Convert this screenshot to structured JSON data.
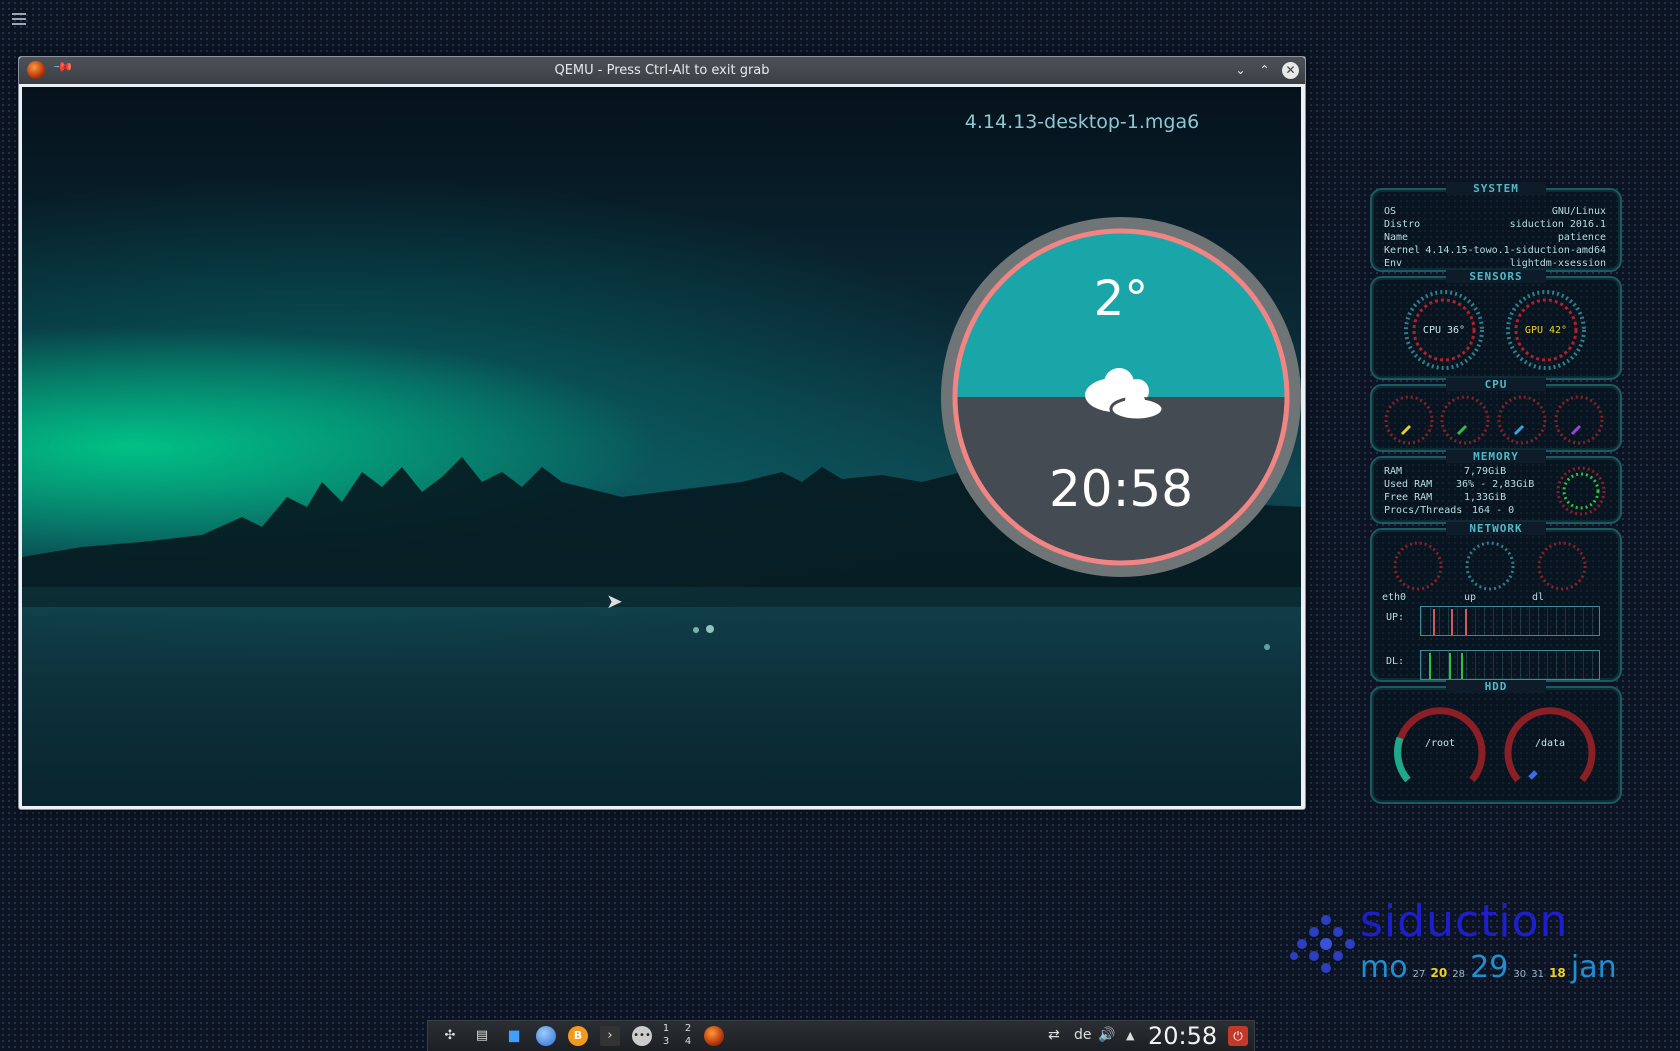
{
  "desktop": {
    "menu_icon": "hamburger-icon"
  },
  "qemu": {
    "title": "QEMU - Press Ctrl-Alt to exit grab",
    "icons": {
      "app": "qemu-icon",
      "pin": "pin-icon",
      "minimize": "chevron-down-icon",
      "maximize": "chevron-up-icon",
      "close": "close-icon"
    },
    "minimize_glyph": "⌄",
    "maximize_glyph": "⌃",
    "close_glyph": "✕",
    "kernel": "4.14.13-desktop-1.mga6",
    "weather": {
      "temperature": "2°",
      "condition_icon": "cloud-icon",
      "time": "20:58"
    }
  },
  "conky": {
    "system": {
      "title": "SYSTEM",
      "rows": [
        {
          "key": "OS",
          "value": "GNU/Linux"
        },
        {
          "key": "Distro",
          "value": "siduction 2016.1"
        },
        {
          "key": "Name",
          "value": "patience"
        },
        {
          "key": "Kernel",
          "value": "4.14.15-towo.1-siduction-amd64"
        },
        {
          "key": " Env",
          "value": "lightdm-xsession"
        }
      ]
    },
    "sensors": {
      "title": "SENSORS",
      "cpu": "CPU 36°",
      "gpu": "GPU 42°"
    },
    "cpu": {
      "title": "CPU"
    },
    "memory": {
      "title": "MEMORY",
      "rows": [
        {
          "key": "RAM",
          "value": "7,79GiB"
        },
        {
          "key": "Used RAM",
          "value": "36% - 2,83GiB"
        },
        {
          "key": "Free RAM",
          "value": "1,33GiB"
        },
        {
          "key": "Procs/Threads",
          "value": "164 - 0"
        }
      ]
    },
    "network": {
      "title": "NETWORK",
      "iface": "eth0",
      "up": "up",
      "dl": "dl",
      "up_label": "UP:",
      "dl_label": "DL:"
    },
    "hdd": {
      "title": "HDD",
      "root": "/root",
      "data": "/data"
    }
  },
  "logo": {
    "brand": "siduction",
    "day_name": "mo",
    "day": "29",
    "month": "jan",
    "mini_prev": "27",
    "mini_28": "28",
    "mini_30": "30",
    "mini_31": "31",
    "day_20": "20",
    "day_18": "18"
  },
  "taskbar": {
    "icons": [
      "application-menu-icon",
      "task-manager-icon",
      "file-manager-icon",
      "browser-icon",
      "bitcoin-icon",
      "terminal-icon",
      "more-icon"
    ],
    "pager": [
      "1",
      "2",
      "3",
      "4"
    ],
    "keyboard_layout": "de",
    "tray": {
      "network": "network-icon",
      "volume": "volume-icon",
      "expand": "arrow-up-icon"
    },
    "clock": "20:58",
    "power": "power-icon"
  }
}
